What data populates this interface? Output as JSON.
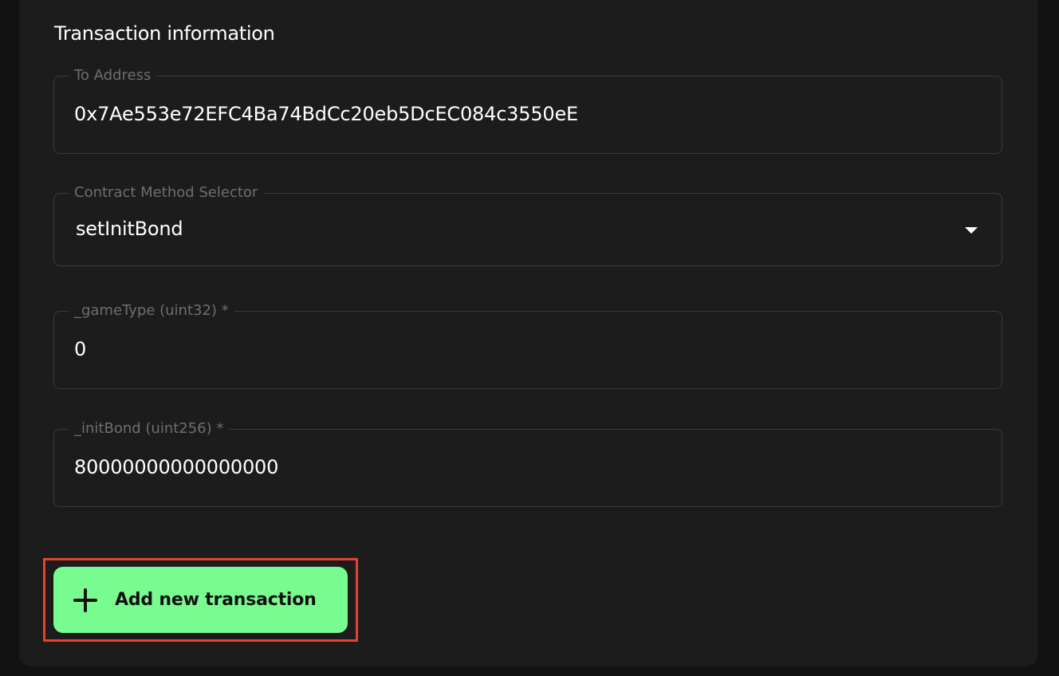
{
  "section_title": "Transaction information",
  "fields": [
    {
      "label": "To Address",
      "value": "0x7Ae553e72EFC4Ba74BdCc20eb5DcEC084c3550eE"
    },
    {
      "label": "Contract Method Selector",
      "value": "setInitBond",
      "type": "select"
    },
    {
      "label": "_gameType (uint32) *",
      "value": "0"
    },
    {
      "label": "_initBond (uint256) *",
      "value": "80000000000000000"
    }
  ],
  "add_button": {
    "label": "Add new transaction",
    "icon": "plus-icon",
    "color": "#78fb8f"
  },
  "highlight_color": "#e5432b"
}
